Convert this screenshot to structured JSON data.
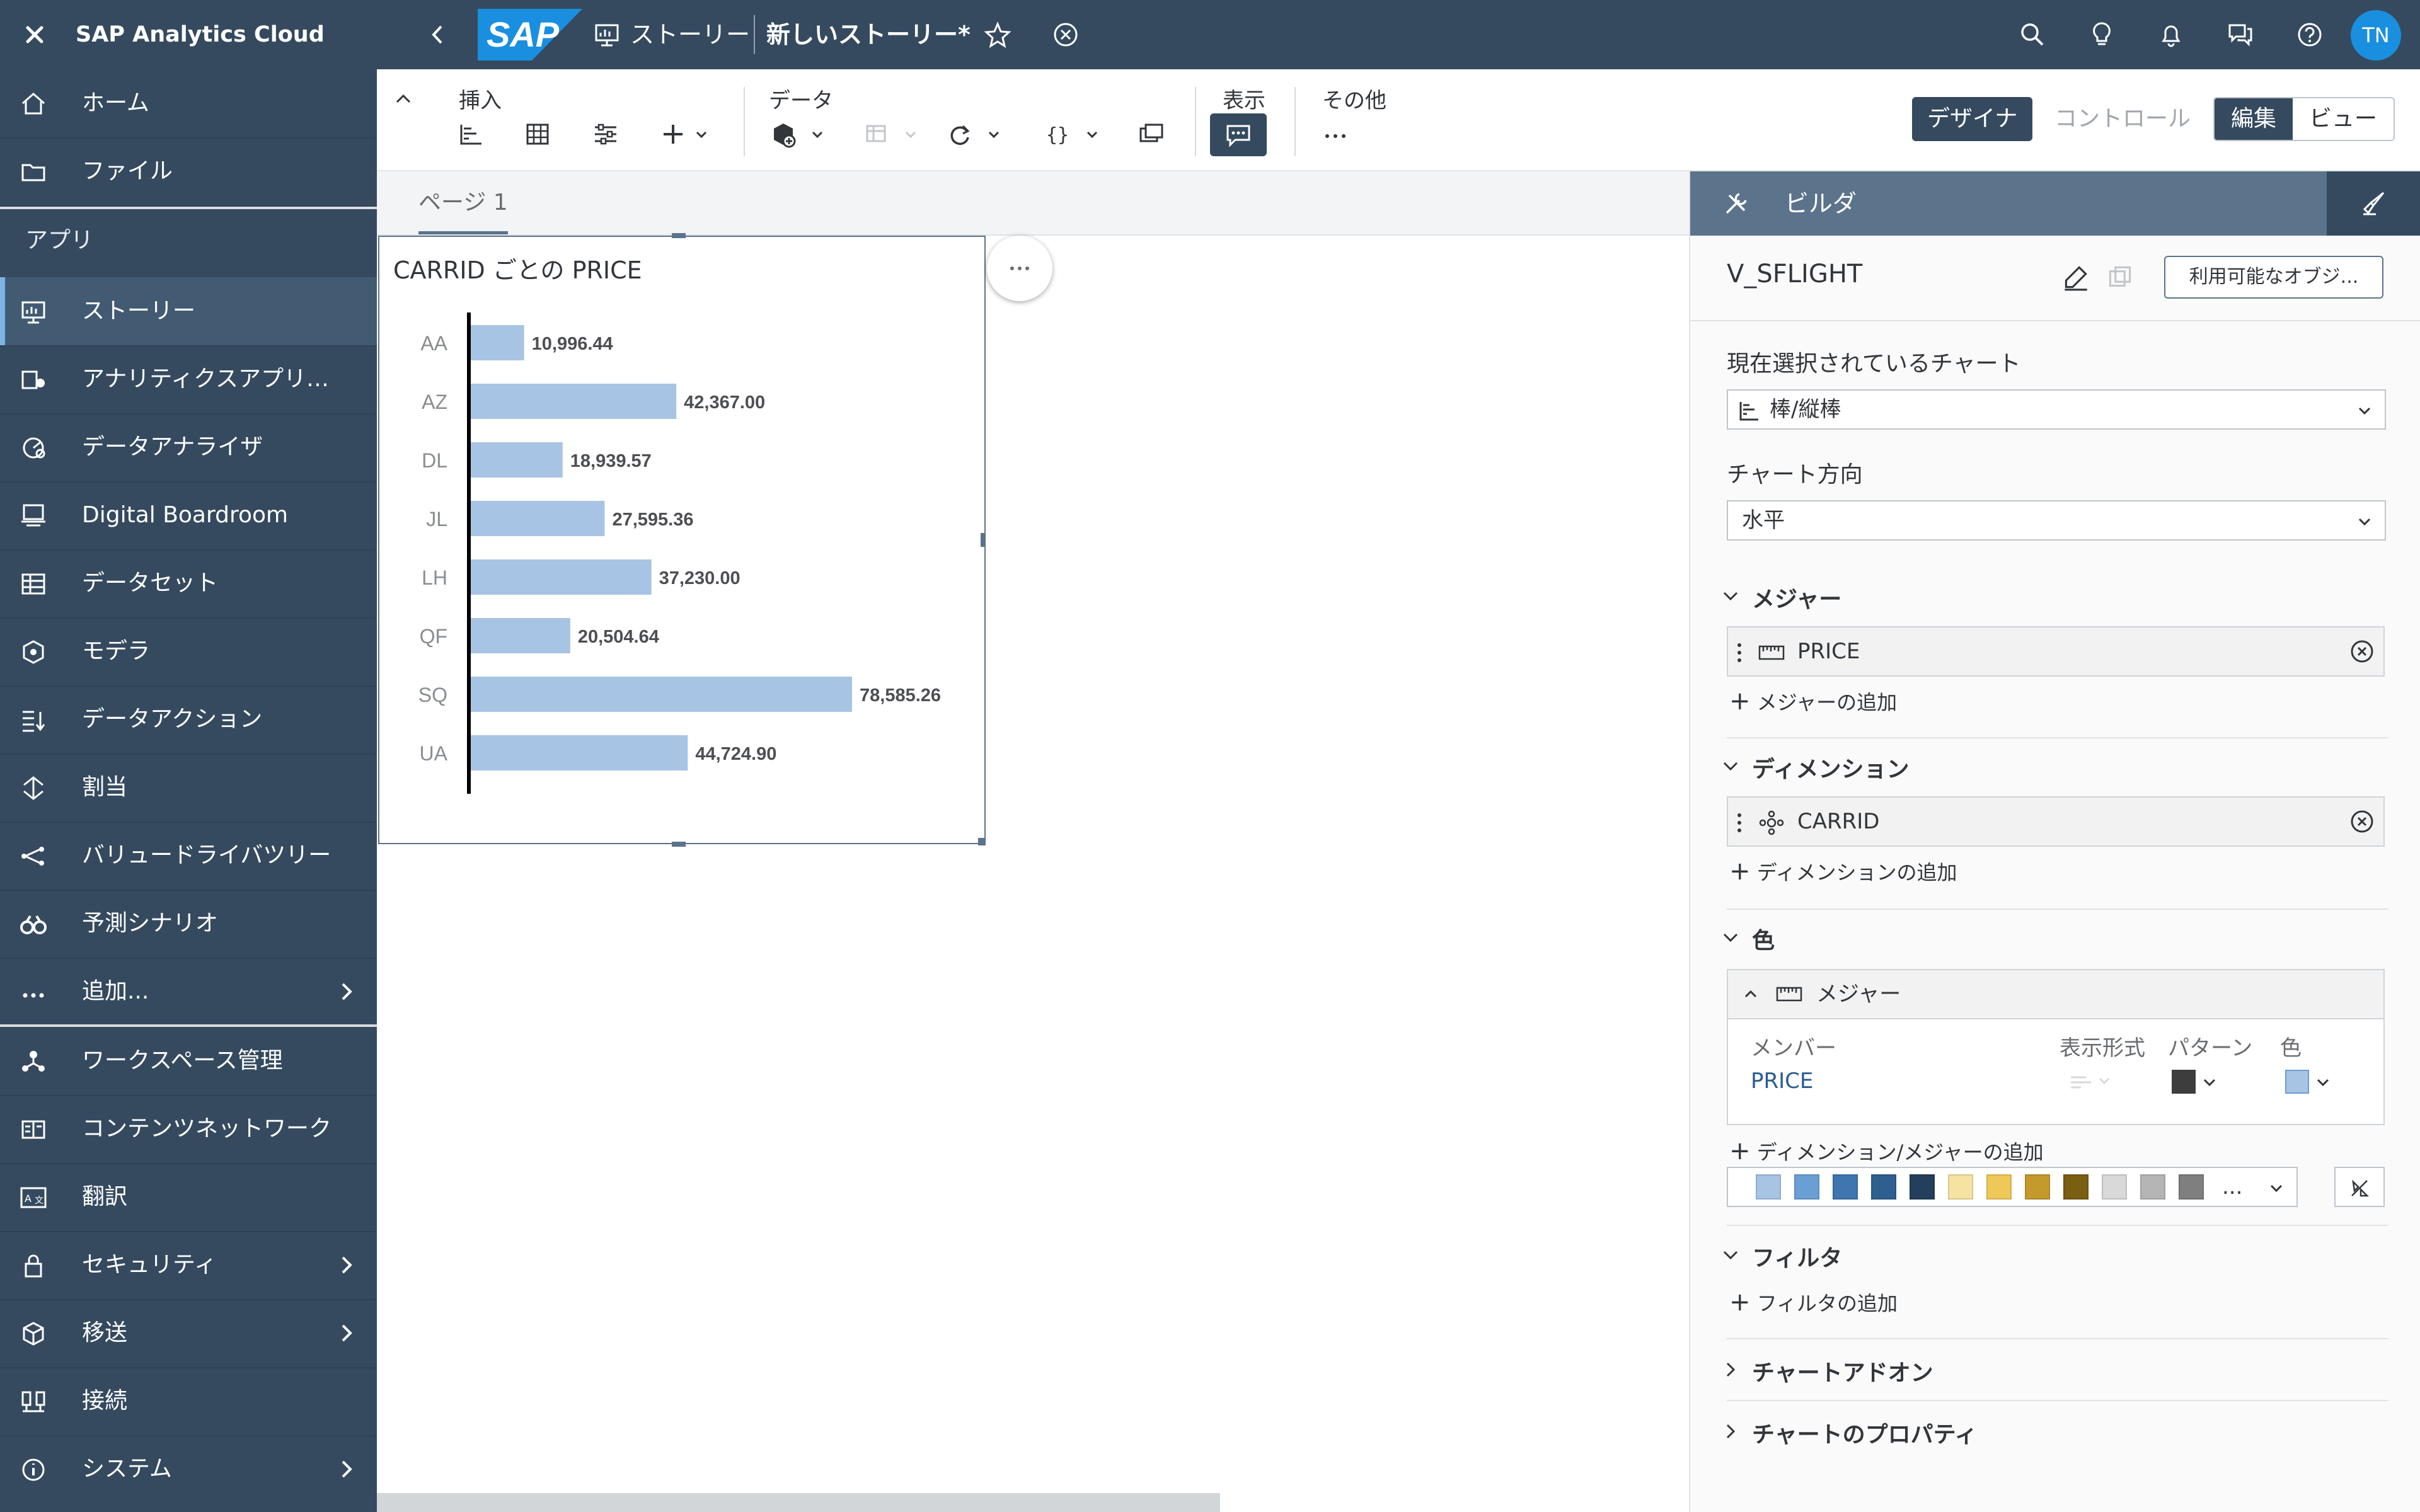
{
  "sidebar": {
    "app_name": "SAP Analytics Cloud",
    "section_label": "アプリ",
    "items": [
      {
        "label": "ホーム",
        "icon": "home-icon"
      },
      {
        "label": "ファイル",
        "icon": "folder-icon"
      },
      {
        "label": "ストーリー",
        "icon": "story-icon",
        "selected": true
      },
      {
        "label": "アナリティクスアプリケ...",
        "icon": "analytic-app-icon"
      },
      {
        "label": "データアナライザ",
        "icon": "data-analyzer-icon"
      },
      {
        "label": "Digital Boardroom",
        "icon": "boardroom-icon"
      },
      {
        "label": "データセット",
        "icon": "dataset-icon"
      },
      {
        "label": "モデラ",
        "icon": "modeler-icon"
      },
      {
        "label": "データアクション",
        "icon": "data-action-icon"
      },
      {
        "label": "割当",
        "icon": "allocation-icon"
      },
      {
        "label": "バリュードライバツリー",
        "icon": "value-driver-icon"
      },
      {
        "label": "予測シナリオ",
        "icon": "predictive-icon"
      },
      {
        "label": "追加...",
        "icon": "more-icon"
      },
      {
        "label": "ワークスペース管理",
        "icon": "workspace-icon"
      },
      {
        "label": "コンテンツネットワーク",
        "icon": "content-network-icon"
      },
      {
        "label": "翻訳",
        "icon": "translate-icon"
      },
      {
        "label": "セキュリティ",
        "icon": "lock-icon"
      },
      {
        "label": "移送",
        "icon": "transport-icon"
      },
      {
        "label": "接続",
        "icon": "connection-icon"
      },
      {
        "label": "システム",
        "icon": "info-icon"
      }
    ]
  },
  "shell": {
    "logo_text": "SAP",
    "story_label": "ストーリー",
    "doc_title": "新しいストーリー*",
    "avatar": "TN"
  },
  "toolbar": {
    "insert_label": "挿入",
    "data_label": "データ",
    "display_label": "表示",
    "other_label": "その他",
    "designer_label": "デザイナ",
    "control_label": "コントロール",
    "edit_label": "編集",
    "view_label": "ビュー"
  },
  "page": {
    "tab_label": "ページ 1"
  },
  "chart_data": {
    "type": "bar",
    "orientation": "horizontal",
    "title": "CARRID ごとの PRICE",
    "categories": [
      "AA",
      "AZ",
      "DL",
      "JL",
      "LH",
      "QF",
      "SQ",
      "UA"
    ],
    "values": [
      10996.44,
      42367.0,
      18939.57,
      27595.36,
      37230.0,
      20504.64,
      78585.26,
      44724.9
    ],
    "value_labels": [
      "10,996.44",
      "42,367.00",
      "18,939.57",
      "27,595.36",
      "37,230.00",
      "20,504.64",
      "78,585.26",
      "44,724.90"
    ],
    "xlabel": "",
    "ylabel": "",
    "grid": false,
    "bar_color": "#a8c4e4"
  },
  "builder": {
    "title": "ビルダ",
    "model_name": "V_SFLIGHT",
    "available_objects": "利用可能なオブジ...",
    "current_chart_label": "現在選択されているチャート",
    "chart_type_value": "棒/縦棒",
    "orientation_label": "チャート方向",
    "orientation_value": "水平",
    "measures_label": "メジャー",
    "measure_item": "PRICE",
    "add_measure": "メジャーの追加",
    "dimensions_label": "ディメンション",
    "dimension_item": "CARRID",
    "add_dimension": "ディメンションの追加",
    "color_label": "色",
    "color_sub_label": "メジャー",
    "col_member": "メンバー",
    "col_format": "表示形式",
    "col_pattern": "パターン",
    "col_color": "色",
    "color_row_member": "PRICE",
    "add_dim_measure": "ディメンション/メジャーの追加",
    "palette": [
      "#a8c4e4",
      "#6a9fd3",
      "#3f76b0",
      "#2f5f8f",
      "#243f5c",
      "#f6e3a1",
      "#efc85a",
      "#c49a2c",
      "#7a5e12",
      "#d9d9d9",
      "#b5b5b5",
      "#7f7f7f"
    ],
    "palette_more": "...",
    "filter_label": "フィルタ",
    "add_filter": "フィルタの追加",
    "addons_label": "チャートアドオン",
    "properties_label": "チャートのプロパティ"
  }
}
